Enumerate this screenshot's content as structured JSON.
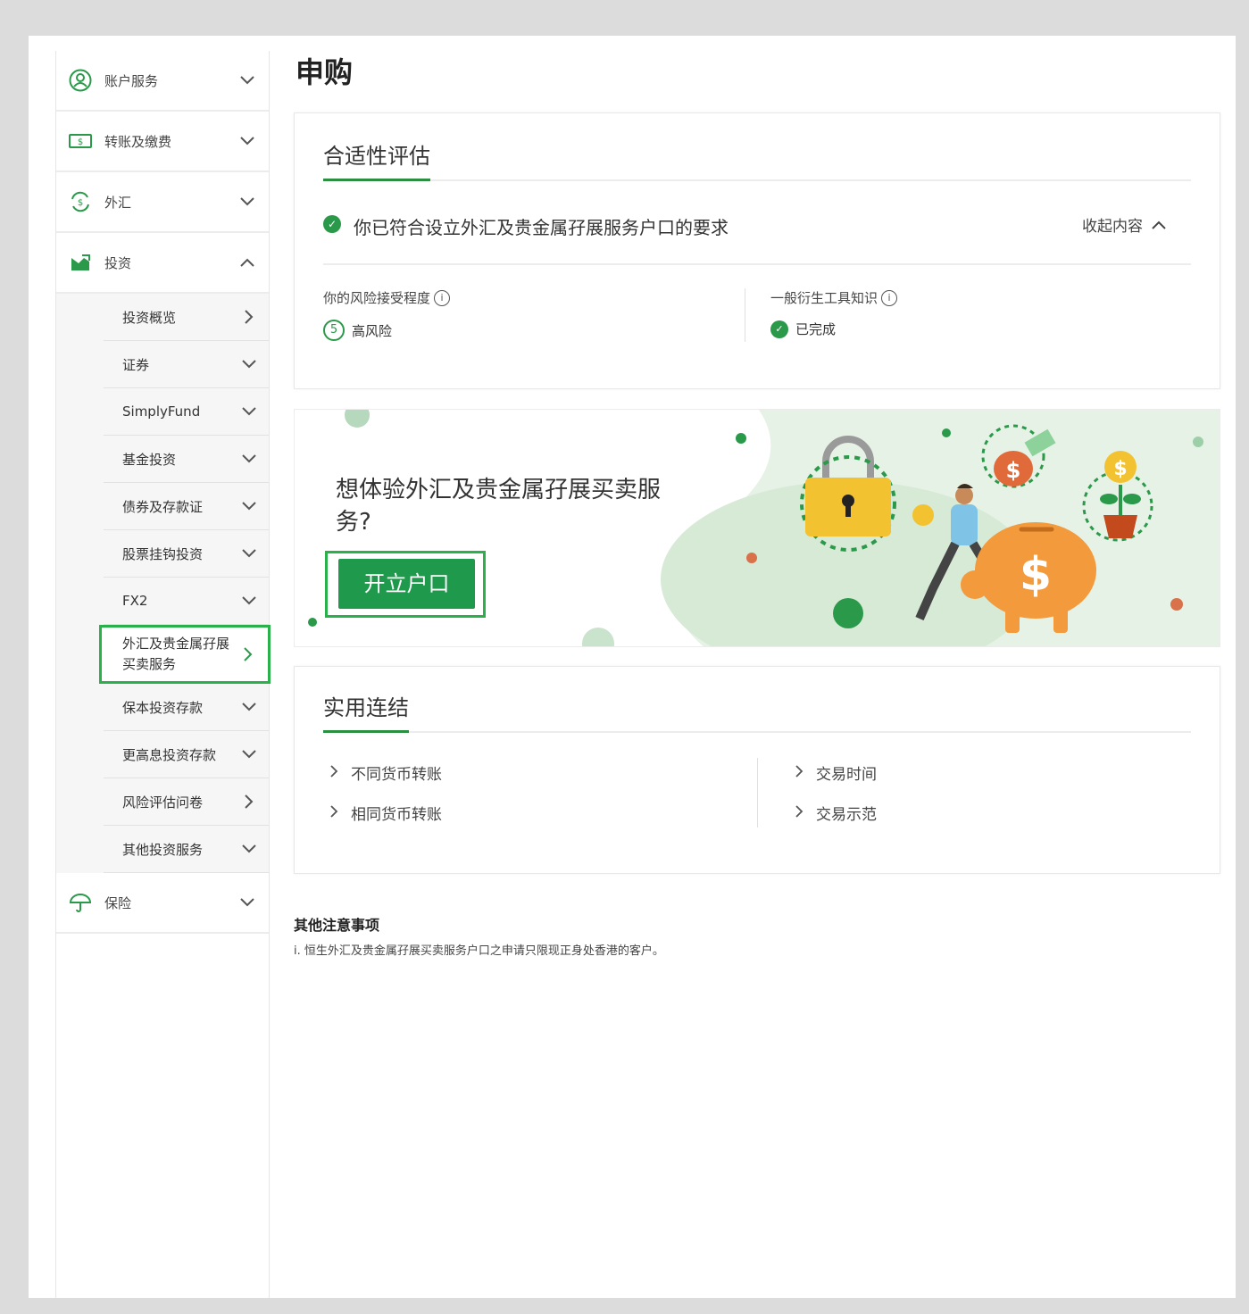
{
  "page": {
    "title": "申购"
  },
  "sidebar": {
    "items": [
      {
        "label": "账户服务",
        "icon": "person-circle-icon",
        "state": "collapsed"
      },
      {
        "label": "转账及缴费",
        "icon": "money-transfer-icon",
        "state": "collapsed"
      },
      {
        "label": "外汇",
        "icon": "currency-exchange-icon",
        "state": "collapsed"
      },
      {
        "label": "投资",
        "icon": "investment-chart-icon",
        "state": "expanded"
      },
      {
        "label": "保险",
        "icon": "umbrella-icon",
        "state": "collapsed"
      }
    ],
    "investment_sub": [
      {
        "label": "投资概览",
        "chev": "right"
      },
      {
        "label": "证券",
        "chev": "down"
      },
      {
        "label": "SimplyFund",
        "chev": "down"
      },
      {
        "label": "基金投资",
        "chev": "down"
      },
      {
        "label": "债券及存款证",
        "chev": "down"
      },
      {
        "label": "股票挂钩投资",
        "chev": "down"
      },
      {
        "label": "FX2",
        "chev": "down"
      },
      {
        "label": "外汇及贵金属孖展买卖服务",
        "chev": "right",
        "active": true
      },
      {
        "label": "保本投资存款",
        "chev": "down"
      },
      {
        "label": "更高息投资存款",
        "chev": "down"
      },
      {
        "label": "风险评估问卷",
        "chev": "right"
      },
      {
        "label": "其他投资服务",
        "chev": "down"
      }
    ]
  },
  "suitability": {
    "heading": "合适性评估",
    "status_text": "你已符合设立外汇及贵金属孖展服务户口的要求",
    "collapse_label": "收起内容",
    "risk_label": "你的风险接受程度",
    "risk_level": "5",
    "risk_value": "高风险",
    "knowledge_label": "一般衍生工具知识",
    "knowledge_value": "已完成"
  },
  "banner": {
    "text": "想体验外汇及贵金属孖展买卖服务?",
    "cta_label": "开立户口"
  },
  "links": {
    "heading": "实用连结",
    "items": [
      "不同货币转账",
      "相同货币转账",
      "交易时间",
      "交易示范"
    ]
  },
  "notes": {
    "title": "其他注意事项",
    "text": "i.  恒生外汇及贵金属孖展买卖服务户口之申请只限现正身处香港的客户。"
  },
  "colors": {
    "brand_green": "#1f9a4c",
    "highlight_green": "#2bb14a",
    "accent_orange": "#f39a3c",
    "gold": "#f2c230"
  }
}
